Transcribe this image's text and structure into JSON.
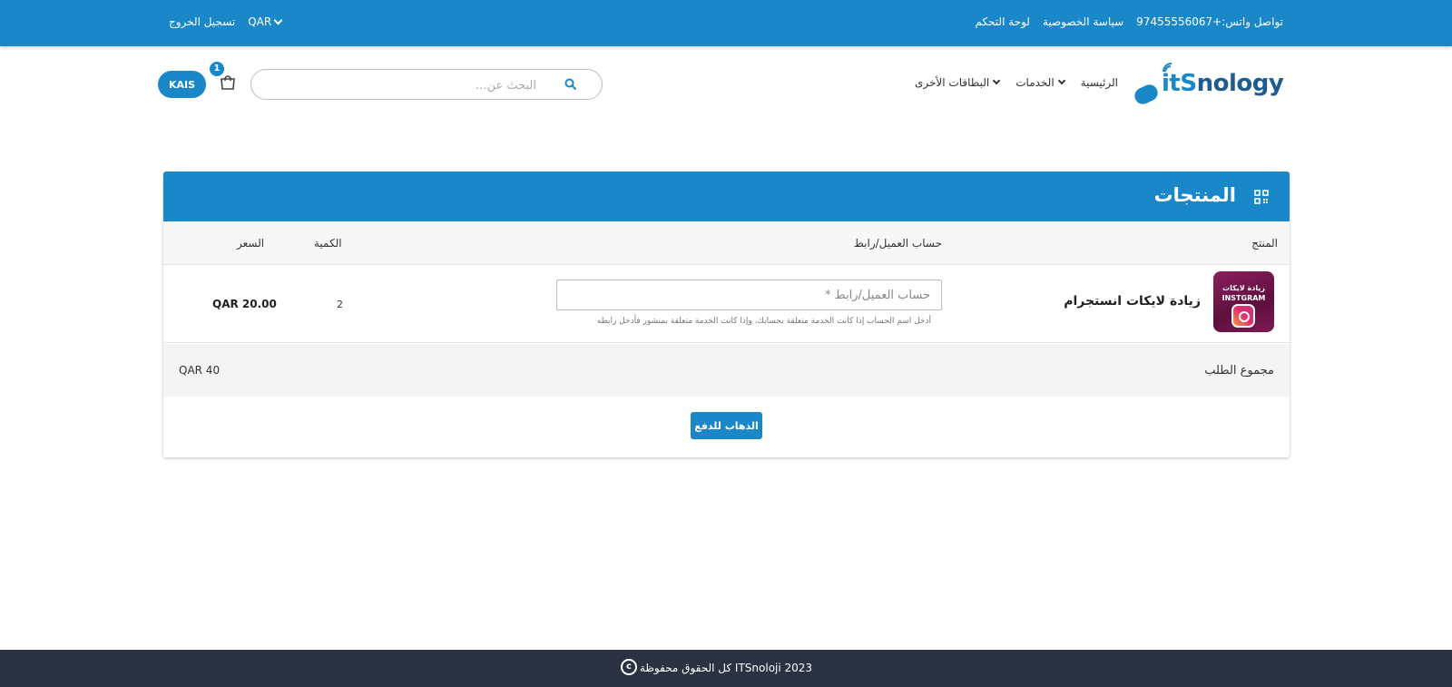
{
  "topbar": {
    "whatsapp": "تواصل واتس:+97455556067",
    "privacy": "سياسة الخصوصية",
    "dashboard": "لوحة التحكم",
    "currency": "QAR",
    "logout": "تسجيل الخروج"
  },
  "logo": {
    "its": "itS",
    "rest": "nology"
  },
  "nav": {
    "home": "الرئيسية",
    "services": "الخدمات",
    "other_cards": "البطاقات الأخرى"
  },
  "search": {
    "placeholder": "البحث عن..."
  },
  "cart": {
    "count": "1"
  },
  "user": {
    "label": "KAIS"
  },
  "panel": {
    "title": "المنتجات"
  },
  "table": {
    "headers": {
      "product": "المنتج",
      "account": "حساب العميل/رابط",
      "quantity": "الكمية",
      "price": "السعر"
    },
    "rows": [
      {
        "image_line1": "زيادة لايكات",
        "image_line2": "INSTGRAM",
        "name": "زيادة لايكات انستجرام",
        "account_placeholder": "حساب العميل/رابط *",
        "hint": "أدخل اسم الحساب إذا كانت الخدمة متعلقة بحسابك، وإذا كانت الخدمة متعلقة بمنشور فأدخل رابطه",
        "quantity": "2",
        "price": "QAR 20.00"
      }
    ]
  },
  "summary": {
    "label": "مجموع الطلب",
    "value": "QAR 40"
  },
  "checkout": {
    "label": "الذهاب للدفع"
  },
  "footer": {
    "text": "كل الحقوق محفوظة   ITSnoloji 2023",
    "copyright_symbol": "c"
  },
  "colors": {
    "primary": "#1a87c9",
    "footer_bg": "#2b3342",
    "logo_dark": "#1e5c8f"
  }
}
